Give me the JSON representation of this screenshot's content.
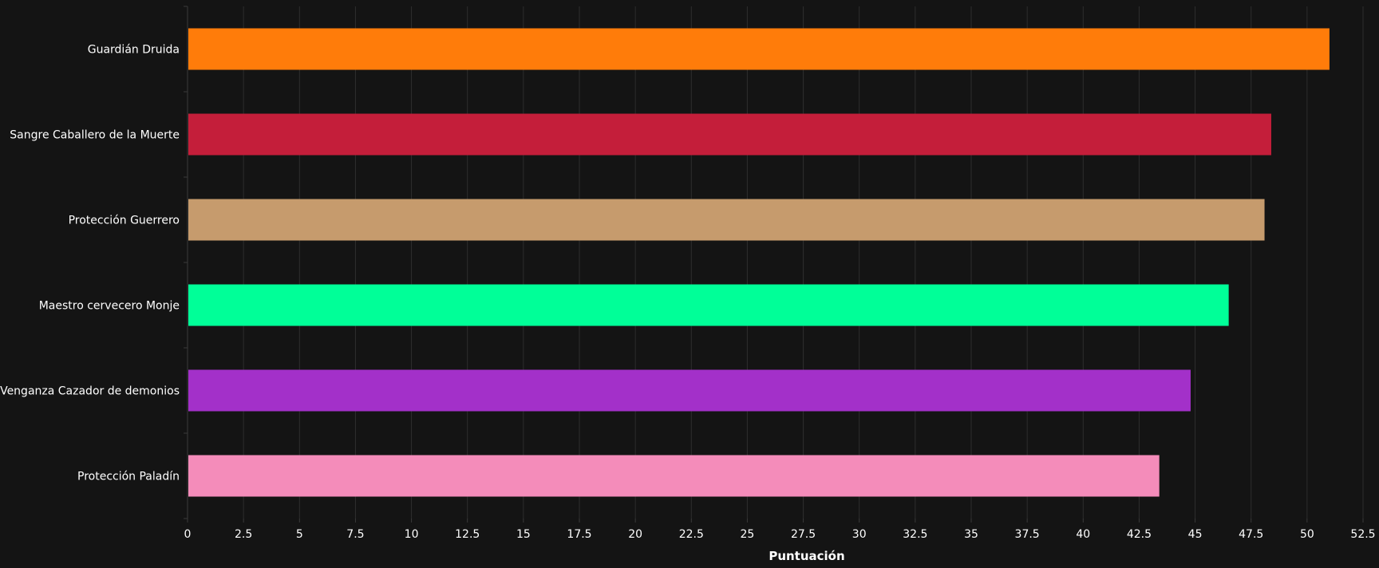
{
  "chart_data": {
    "type": "bar",
    "orientation": "horizontal",
    "categories": [
      "Guardián Druida",
      "Sangre Caballero de la Muerte",
      "Protección Guerrero",
      "Maestro cervecero Monje",
      "Venganza Cazador de demonios",
      "Protección Paladín"
    ],
    "values": [
      51.0,
      48.4,
      48.1,
      46.5,
      44.8,
      43.4
    ],
    "colors": [
      "#ff7c0a",
      "#c41e3a",
      "#c69b6d",
      "#00ff98",
      "#a330c9",
      "#f48cba"
    ],
    "xlabel": "Puntuación",
    "ylabel": "",
    "xlim": [
      0,
      52.5
    ],
    "x_ticks": [
      "0",
      "2.5",
      "5",
      "7.5",
      "10",
      "12.5",
      "15",
      "17.5",
      "20",
      "22.5",
      "25",
      "27.5",
      "30",
      "32.5",
      "35",
      "37.5",
      "40",
      "42.5",
      "45",
      "47.5",
      "50",
      "52.5"
    ],
    "grid": "vertical",
    "legend": "none"
  },
  "style": {
    "background": "#141414",
    "grid_color": "#2e2e2e",
    "axis_color": "#3a3a3a",
    "text_color": "#ffffff"
  }
}
